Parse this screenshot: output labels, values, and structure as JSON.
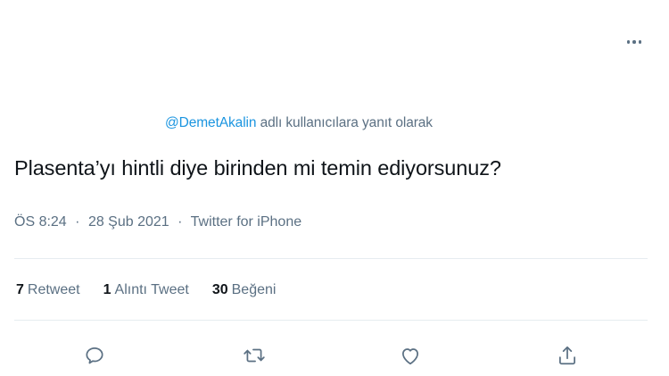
{
  "tweet": {
    "reply_context": {
      "mention": "@DemetAkalin",
      "suffix": " adlı kullanıcılara yanıt olarak"
    },
    "text": "Plasenta’yı hintli diye birinden mi temin ediyorsunuz?",
    "meta": {
      "time": "ÖS 8:24",
      "separator": "·",
      "date": "28 Şub 2021",
      "source": "Twitter for iPhone"
    },
    "stats": {
      "retweets": {
        "count": "7",
        "label": "Retweet"
      },
      "quotes": {
        "count": "1",
        "label": "Alıntı Tweet"
      },
      "likes": {
        "count": "30",
        "label": "Beğeni"
      }
    },
    "actions": [
      {
        "icon": "reply-icon"
      },
      {
        "icon": "retweet-icon"
      },
      {
        "icon": "like-icon"
      },
      {
        "icon": "share-icon"
      }
    ],
    "colors": {
      "text": "#0f1419",
      "secondary": "#5b7083",
      "link": "#1b95e0",
      "divider": "#e6ecf0"
    }
  }
}
